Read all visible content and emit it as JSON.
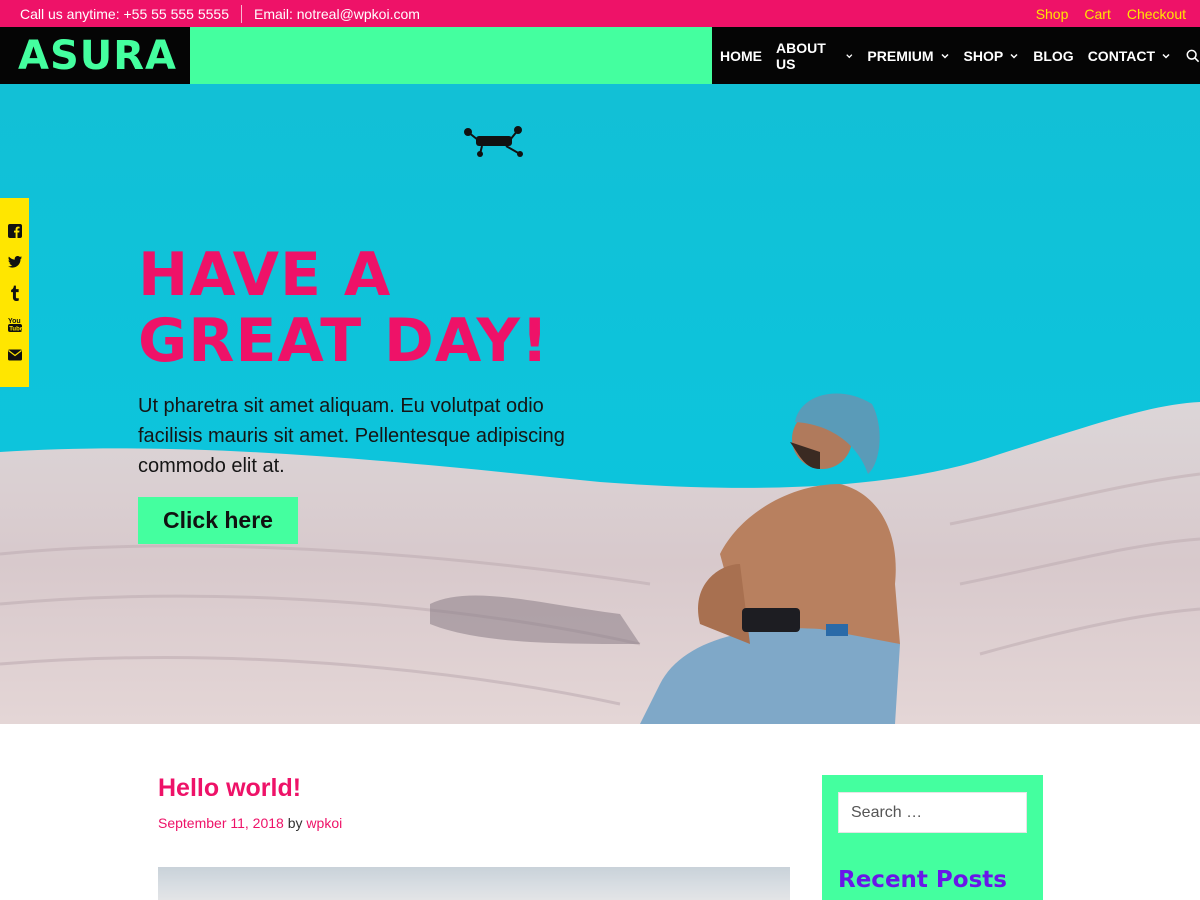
{
  "topbar": {
    "phone": "Call us anytime: +55 55 555 5555",
    "email": "Email: notreal@wpkoi.com",
    "links": [
      "Shop",
      "Cart",
      "Checkout"
    ]
  },
  "header": {
    "logo": "ASURA",
    "nav": [
      {
        "label": "HOME",
        "dropdown": false
      },
      {
        "label": "ABOUT US",
        "dropdown": true
      },
      {
        "label": "PREMIUM",
        "dropdown": true
      },
      {
        "label": "SHOP",
        "dropdown": true
      },
      {
        "label": "BLOG",
        "dropdown": false
      },
      {
        "label": "CONTACT",
        "dropdown": true
      }
    ],
    "search_icon": "search-icon"
  },
  "hero": {
    "title_line1": "HAVE A",
    "title_line2": "GREAT DAY!",
    "text": "Ut pharetra sit amet aliquam. Eu volutpat odio facilisis mauris sit amet. Pellentesque adipiscing commodo elit at.",
    "button": "Click here"
  },
  "social": [
    "facebook-icon",
    "twitter-icon",
    "tumblr-icon",
    "youtube-icon",
    "email-icon"
  ],
  "post": {
    "title": "Hello world!",
    "date": "September 11, 2018",
    "by": "by",
    "author": "wpkoi"
  },
  "sidebar": {
    "search_placeholder": "Search …",
    "widget_title": "Recent Posts"
  },
  "colors": {
    "pink": "#ee1268",
    "green": "#44ff9f",
    "yellow": "#ffe600",
    "purple": "#6a16e8",
    "black": "#050505"
  }
}
